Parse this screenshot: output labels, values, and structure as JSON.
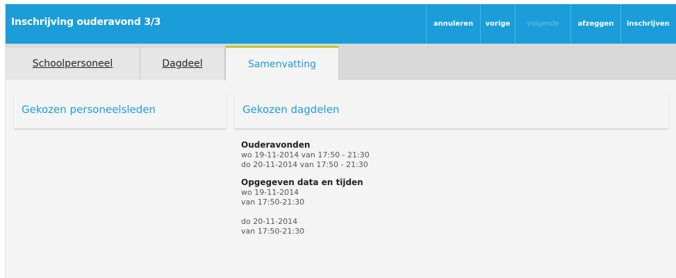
{
  "header": {
    "title": "Inschrijving ouderavond 3/3",
    "actions": [
      {
        "label": "annuleren"
      },
      {
        "label": "vorige"
      },
      {
        "label": "volgende",
        "disabled": true
      },
      {
        "label": "afzeggen"
      },
      {
        "label": "inschrijven"
      }
    ]
  },
  "tabs": [
    {
      "label": "Schoolpersoneel"
    },
    {
      "label": "Dagdeel"
    },
    {
      "label": "Samenvatting",
      "active": true
    }
  ],
  "panels": {
    "staff_title": "Gekozen personeelsleden",
    "dayparts_title": "Gekozen dagdelen"
  },
  "summary": {
    "evenings_title": "Ouderavonden",
    "evenings": [
      "wo 19-11-2014 van 17:50 - 21:30",
      "do 20-11-2014 van 17:50 - 21:30"
    ],
    "given_title": "Opgegeven data en tijden",
    "given": [
      {
        "date": "wo 19-11-2014",
        "time": "van 17:50-21:30"
      },
      {
        "date": "do 20-11-2014",
        "time": "van 17:50-21:30"
      }
    ]
  },
  "colors": {
    "header_blue": "#1a9dd9",
    "active_tab_accent": "#b6cd33"
  }
}
